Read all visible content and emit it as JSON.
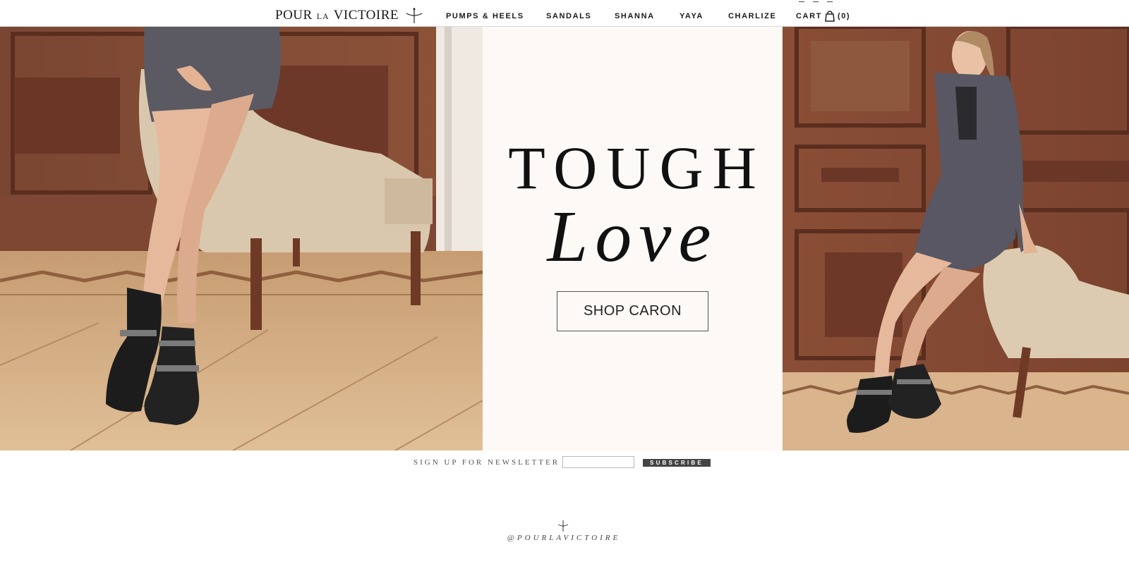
{
  "brand": {
    "word1": "POUR",
    "word2": "LA",
    "word3": "VICTOIRE",
    "logo_icon": "sword-mark-icon"
  },
  "nav": {
    "items": [
      {
        "label": "PUMPS & HEELS"
      },
      {
        "label": "SANDALS"
      },
      {
        "label": "SHANNA"
      },
      {
        "label": "YAYA"
      },
      {
        "label": "CHARLIZE"
      }
    ],
    "cart_label": "CART",
    "cart_count": "(0)",
    "cart_icon": "shopping-bag-icon"
  },
  "hero": {
    "headline_line1": "TOUGH",
    "headline_line2": "Love",
    "cta_label": "SHOP CARON",
    "panel_color": "#fdf9f6"
  },
  "newsletter": {
    "label": "SIGN UP FOR NEWSLETTER",
    "input_value": "",
    "button_label": "SUBSCRIBE"
  },
  "footer": {
    "handle": "@POURLAVICTOIRE",
    "mark_icon": "sword-mark-icon"
  }
}
